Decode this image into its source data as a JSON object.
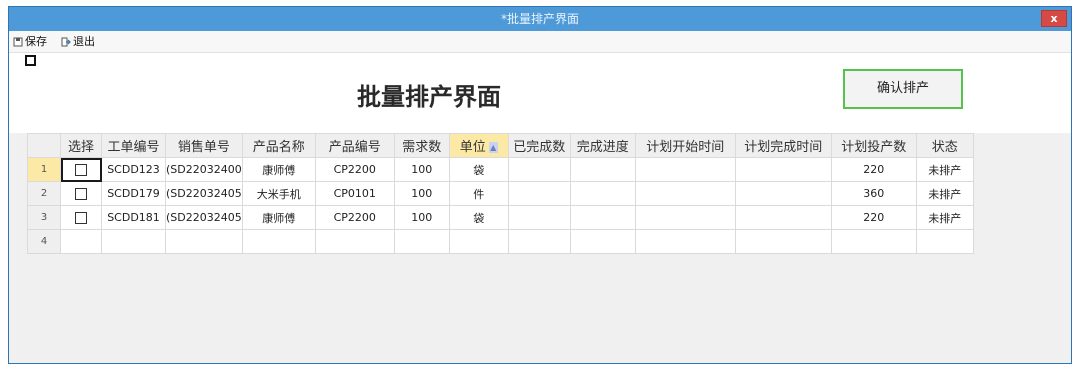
{
  "window": {
    "title": "*批量排产界面",
    "close_label": "x"
  },
  "toolbar": {
    "save_label": "保存",
    "exit_label": "退出"
  },
  "header": {
    "title": "批量排产界面",
    "confirm_label": "确认排产"
  },
  "grid": {
    "columns": [
      "选择",
      "工单编号",
      "销售单号",
      "产品名称",
      "产品编号",
      "需求数",
      "单位",
      "已完成数",
      "完成进度",
      "计划开始时间",
      "计划完成时间",
      "计划投产数",
      "状态"
    ],
    "sort_indicator": "▲",
    "rows": [
      {
        "num": "1",
        "work_order": "SCDD123",
        "sales_order": "(SD22032400",
        "product_name": "康师傅",
        "product_code": "CP2200",
        "demand": "100",
        "unit": "袋",
        "completed": "",
        "progress": "",
        "plan_start": "",
        "plan_end": "",
        "plan_qty": "220",
        "status": "未排产"
      },
      {
        "num": "2",
        "work_order": "SCDD179",
        "sales_order": "(SD22032405",
        "product_name": "大米手机",
        "product_code": "CP0101",
        "demand": "100",
        "unit": "件",
        "completed": "",
        "progress": "",
        "plan_start": "",
        "plan_end": "",
        "plan_qty": "360",
        "status": "未排产"
      },
      {
        "num": "3",
        "work_order": "SCDD181",
        "sales_order": "(SD22032405",
        "product_name": "康师傅",
        "product_code": "CP2200",
        "demand": "100",
        "unit": "袋",
        "completed": "",
        "progress": "",
        "plan_start": "",
        "plan_end": "",
        "plan_qty": "220",
        "status": "未排产"
      },
      {
        "num": "4"
      }
    ]
  }
}
